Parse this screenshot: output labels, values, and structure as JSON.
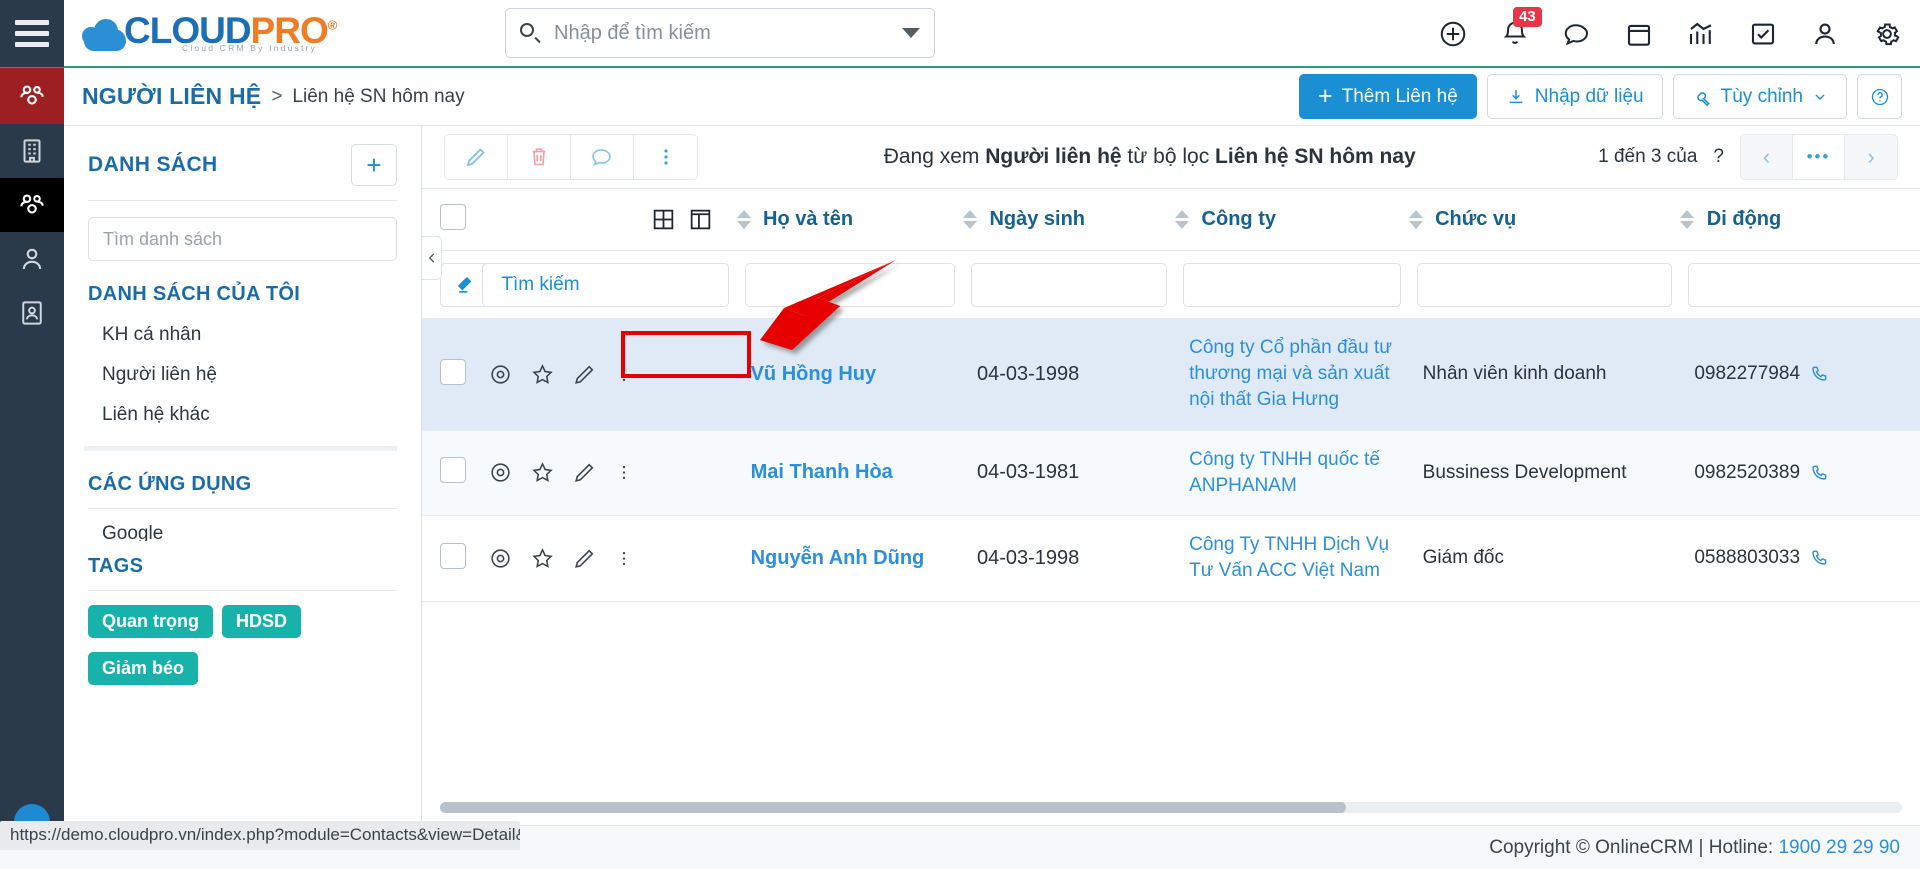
{
  "header": {
    "logo_main": "CLOUD",
    "logo_accent": "PRO",
    "logo_tagline": "Cloud CRM By Industry",
    "search_placeholder": "Nhập để tìm kiếm",
    "search_value": "",
    "notification_count": "43",
    "icons": [
      "add-circle-icon",
      "bell-icon",
      "chat-icon",
      "calendar-icon",
      "analytics-icon",
      "task-icon",
      "user-icon",
      "gear-icon"
    ]
  },
  "breadcrumb": {
    "module": "NGƯỜI LIÊN HỆ",
    "separator": ">",
    "current": "Liên hệ SN hôm nay"
  },
  "actions": {
    "add_label": "Thêm Liên hệ",
    "import_label": "Nhập dữ liệu",
    "customize_label": "Tùy chỉnh",
    "help_label": "?"
  },
  "listpanel": {
    "title": "DANH SÁCH",
    "add_label": "+",
    "search_placeholder": "Tìm danh sách",
    "search_value": "",
    "my_lists_title": "DANH SÁCH CỦA TÔI",
    "my_lists": [
      "KH cá nhân",
      "Người liên hệ",
      "Liên hệ khác"
    ],
    "apps_title": "CÁC ỨNG DỤNG",
    "apps_clipped": "Google",
    "tags_title": "TAGS",
    "tags": [
      "Quan trọng",
      "HDSD",
      "Giảm béo"
    ]
  },
  "toolbar": {
    "buttons": [
      "edit-icon",
      "delete-icon",
      "comment-icon",
      "more-icon"
    ],
    "viewing_prefix": "Đang xem",
    "viewing_module": "Người liên hệ",
    "viewing_middle": "từ bộ lọc",
    "viewing_filter": "Liên hệ SN hôm nay",
    "pager_text": "1 đến 3 của",
    "pager_total": "?",
    "pager_prev": "‹",
    "pager_more": "•••",
    "pager_next": "›"
  },
  "table": {
    "columns": [
      "Họ và tên",
      "Ngày sinh",
      "Công ty",
      "Chức vụ",
      "Di động"
    ],
    "filter_erase_icon": "eraser-icon",
    "filter_search_label": "Tìm kiếm",
    "filter_values": [
      "",
      "",
      "",
      "",
      ""
    ],
    "rows": [
      {
        "name": "Vũ Hồng Huy",
        "birthday": "04-03-1998",
        "company": "Công ty Cổ phần đầu tư thương mại và sản xuất nội thất Gia Hưng",
        "position": "Nhân viên kinh doanh",
        "mobile": "0982277984",
        "selected": true
      },
      {
        "name": "Mai Thanh Hòa",
        "birthday": "04-03-1981",
        "company": "Công ty TNHH quốc tế ANPHANAM",
        "position": "Bussiness Development",
        "mobile": "0982520389",
        "selected": false
      },
      {
        "name": "Nguyễn Anh Dũng",
        "birthday": "04-03-1998",
        "company": "Công Ty TNHH Dịch Vụ Tư Vấn ACC Việt Nam",
        "position": "Giám đốc",
        "mobile": "0588803033",
        "selected": false
      }
    ]
  },
  "status": {
    "url": "https://demo.cloudpro.vn/index.php?module=Contacts&view=Detail&recor..."
  },
  "footer": {
    "copyright": "Copyright © OnlineCRM | Hotline: ",
    "hotline": "1900 29 29 90"
  },
  "colors": {
    "accent_blue": "#1a8fd4",
    "brand_orange": "#f07c26",
    "rail_dark": "#2b3a4a",
    "rail_red": "#9d1f22",
    "tag_teal": "#17b3ab",
    "badge_red": "#e8354a",
    "annotation_red": "#e60000"
  }
}
